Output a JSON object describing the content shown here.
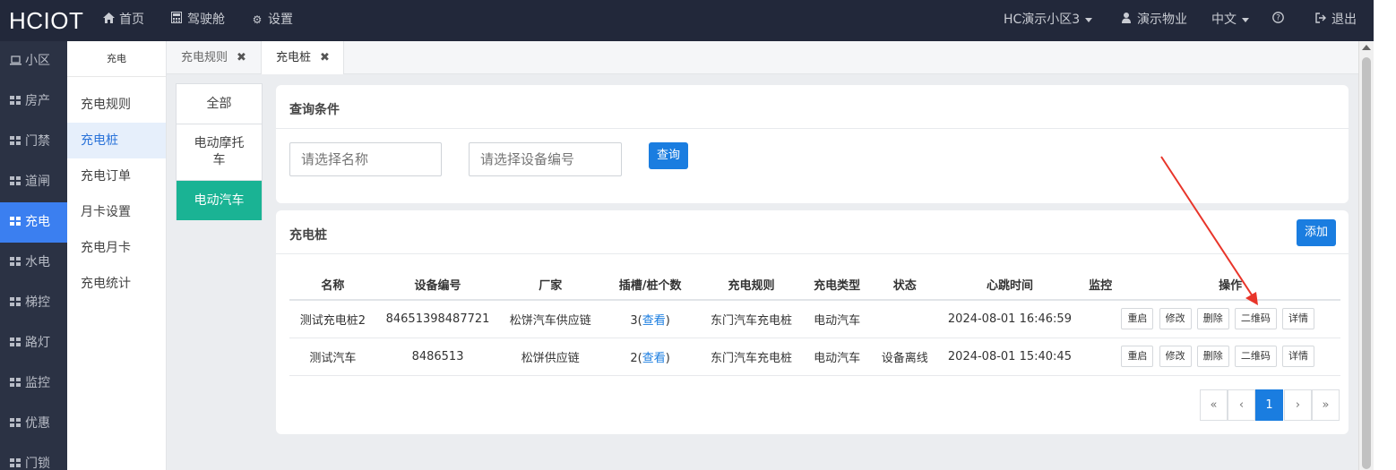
{
  "header": {
    "brand": "HCIOT",
    "nav": [
      {
        "label": "首页",
        "icon": "home-icon"
      },
      {
        "label": "驾驶舱",
        "icon": "calculator-icon"
      },
      {
        "label": "设置",
        "icon": "gear-icon"
      }
    ],
    "community": "HC演示小区3",
    "user": "演示物业",
    "language": "中文",
    "logout": "退出"
  },
  "sidebar": {
    "items": [
      {
        "label": "小区",
        "icon": "laptop-icon"
      },
      {
        "label": "房产",
        "icon": "grid-icon"
      },
      {
        "label": "门禁",
        "icon": "grid-icon"
      },
      {
        "label": "道闸",
        "icon": "grid-icon"
      },
      {
        "label": "充电",
        "icon": "grid-icon",
        "active": true
      },
      {
        "label": "水电",
        "icon": "grid-icon"
      },
      {
        "label": "梯控",
        "icon": "grid-icon"
      },
      {
        "label": "路灯",
        "icon": "grid-icon"
      },
      {
        "label": "监控",
        "icon": "grid-icon"
      },
      {
        "label": "优惠",
        "icon": "grid-icon"
      },
      {
        "label": "门锁",
        "icon": "grid-icon"
      }
    ]
  },
  "submenu": {
    "title": "充电",
    "items": [
      "充电规则",
      "充电桩",
      "充电订单",
      "月卡设置",
      "充电月卡",
      "充电统计"
    ],
    "active_index": 1
  },
  "tabs": [
    {
      "label": "充电规则",
      "close": "✖"
    },
    {
      "label": "充电桩",
      "close": "✖",
      "active": true
    }
  ],
  "type_filter": {
    "items": [
      "全部",
      "电动摩托车",
      "电动汽车"
    ],
    "active_index": 2
  },
  "query": {
    "title": "查询条件",
    "name_placeholder": "请选择名称",
    "code_placeholder": "请选择设备编号",
    "search_label": "查询"
  },
  "list": {
    "title": "充电桩",
    "add_label": "添加",
    "columns": [
      "名称",
      "设备编号",
      "厂家",
      "插槽/桩个数",
      "充电规则",
      "充电类型",
      "状态",
      "心跳时间",
      "监控",
      "操作"
    ],
    "rows": [
      {
        "name": "测试充电桩2",
        "code": "84651398487721",
        "vendor": "松饼汽车供应链",
        "slots": "3",
        "view": "查看",
        "rule": "东门汽车充电桩",
        "type": "电动汽车",
        "status": "",
        "heartbeat": "2024-08-01 16:46:59",
        "monitor": ""
      },
      {
        "name": "测试汽车",
        "code": "8486513",
        "vendor": "松饼供应链",
        "slots": "2",
        "view": "查看",
        "rule": "东门汽车充电桩",
        "type": "电动汽车",
        "status": "设备离线",
        "heartbeat": "2024-08-01 15:40:45",
        "monitor": ""
      }
    ],
    "actions": [
      "重启",
      "修改",
      "删除",
      "二维码",
      "详情"
    ]
  },
  "pagination": {
    "first": "«",
    "prev": "‹",
    "current": "1",
    "next": "›",
    "last": "»"
  },
  "colors": {
    "topbar": "#22283a",
    "sidebar": "#2b3244",
    "accent": "#3b7ff0",
    "primary": "#1a7de0",
    "teal": "#1ab394",
    "annotation_arrow": "#e8352a"
  }
}
